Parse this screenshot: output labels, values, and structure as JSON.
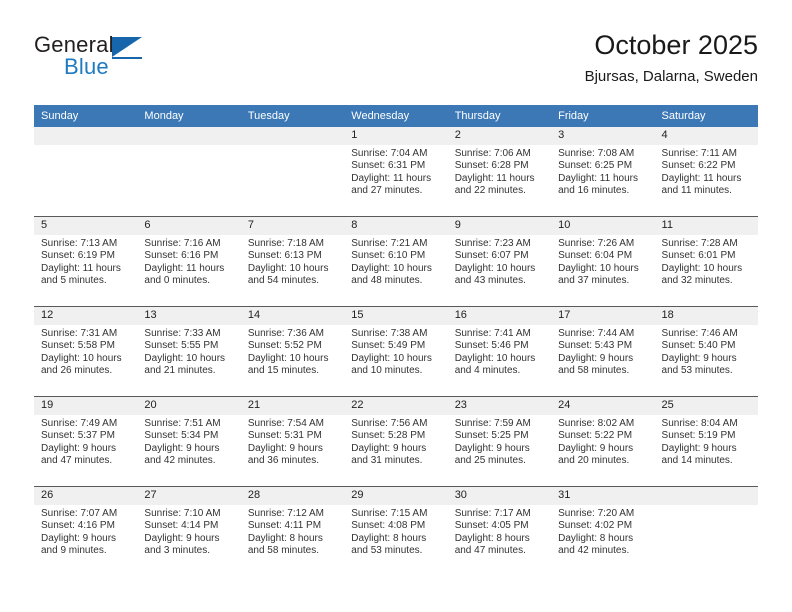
{
  "brand": {
    "name_top": "General",
    "name_bottom": "Blue",
    "flag_icon": "blue-triangle-flag-icon",
    "accent_color": "#1766ab"
  },
  "header": {
    "title": "October 2025",
    "subtitle": "Bjursas, Dalarna, Sweden"
  },
  "theme": {
    "header_bar": "#3b78b5",
    "daynum_band": "#f0f0f0",
    "row_divider": "#5a5a5a",
    "text": "#333333"
  },
  "weekday_headers": [
    "Sunday",
    "Monday",
    "Tuesday",
    "Wednesday",
    "Thursday",
    "Friday",
    "Saturday"
  ],
  "labels": {
    "sunrise": "Sunrise:",
    "sunset": "Sunset:",
    "daylight": "Daylight:"
  },
  "weeks": [
    [
      {
        "day": "",
        "sunrise": "",
        "sunset": "",
        "daylight": "",
        "blank": true
      },
      {
        "day": "",
        "sunrise": "",
        "sunset": "",
        "daylight": "",
        "blank": true
      },
      {
        "day": "",
        "sunrise": "",
        "sunset": "",
        "daylight": "",
        "blank": true
      },
      {
        "day": "1",
        "sunrise": "Sunrise: 7:04 AM",
        "sunset": "Sunset: 6:31 PM",
        "daylight": "Daylight: 11 hours and 27 minutes."
      },
      {
        "day": "2",
        "sunrise": "Sunrise: 7:06 AM",
        "sunset": "Sunset: 6:28 PM",
        "daylight": "Daylight: 11 hours and 22 minutes."
      },
      {
        "day": "3",
        "sunrise": "Sunrise: 7:08 AM",
        "sunset": "Sunset: 6:25 PM",
        "daylight": "Daylight: 11 hours and 16 minutes."
      },
      {
        "day": "4",
        "sunrise": "Sunrise: 7:11 AM",
        "sunset": "Sunset: 6:22 PM",
        "daylight": "Daylight: 11 hours and 11 minutes."
      }
    ],
    [
      {
        "day": "5",
        "sunrise": "Sunrise: 7:13 AM",
        "sunset": "Sunset: 6:19 PM",
        "daylight": "Daylight: 11 hours and 5 minutes."
      },
      {
        "day": "6",
        "sunrise": "Sunrise: 7:16 AM",
        "sunset": "Sunset: 6:16 PM",
        "daylight": "Daylight: 11 hours and 0 minutes."
      },
      {
        "day": "7",
        "sunrise": "Sunrise: 7:18 AM",
        "sunset": "Sunset: 6:13 PM",
        "daylight": "Daylight: 10 hours and 54 minutes."
      },
      {
        "day": "8",
        "sunrise": "Sunrise: 7:21 AM",
        "sunset": "Sunset: 6:10 PM",
        "daylight": "Daylight: 10 hours and 48 minutes."
      },
      {
        "day": "9",
        "sunrise": "Sunrise: 7:23 AM",
        "sunset": "Sunset: 6:07 PM",
        "daylight": "Daylight: 10 hours and 43 minutes."
      },
      {
        "day": "10",
        "sunrise": "Sunrise: 7:26 AM",
        "sunset": "Sunset: 6:04 PM",
        "daylight": "Daylight: 10 hours and 37 minutes."
      },
      {
        "day": "11",
        "sunrise": "Sunrise: 7:28 AM",
        "sunset": "Sunset: 6:01 PM",
        "daylight": "Daylight: 10 hours and 32 minutes."
      }
    ],
    [
      {
        "day": "12",
        "sunrise": "Sunrise: 7:31 AM",
        "sunset": "Sunset: 5:58 PM",
        "daylight": "Daylight: 10 hours and 26 minutes."
      },
      {
        "day": "13",
        "sunrise": "Sunrise: 7:33 AM",
        "sunset": "Sunset: 5:55 PM",
        "daylight": "Daylight: 10 hours and 21 minutes."
      },
      {
        "day": "14",
        "sunrise": "Sunrise: 7:36 AM",
        "sunset": "Sunset: 5:52 PM",
        "daylight": "Daylight: 10 hours and 15 minutes."
      },
      {
        "day": "15",
        "sunrise": "Sunrise: 7:38 AM",
        "sunset": "Sunset: 5:49 PM",
        "daylight": "Daylight: 10 hours and 10 minutes."
      },
      {
        "day": "16",
        "sunrise": "Sunrise: 7:41 AM",
        "sunset": "Sunset: 5:46 PM",
        "daylight": "Daylight: 10 hours and 4 minutes."
      },
      {
        "day": "17",
        "sunrise": "Sunrise: 7:44 AM",
        "sunset": "Sunset: 5:43 PM",
        "daylight": "Daylight: 9 hours and 58 minutes."
      },
      {
        "day": "18",
        "sunrise": "Sunrise: 7:46 AM",
        "sunset": "Sunset: 5:40 PM",
        "daylight": "Daylight: 9 hours and 53 minutes."
      }
    ],
    [
      {
        "day": "19",
        "sunrise": "Sunrise: 7:49 AM",
        "sunset": "Sunset: 5:37 PM",
        "daylight": "Daylight: 9 hours and 47 minutes."
      },
      {
        "day": "20",
        "sunrise": "Sunrise: 7:51 AM",
        "sunset": "Sunset: 5:34 PM",
        "daylight": "Daylight: 9 hours and 42 minutes."
      },
      {
        "day": "21",
        "sunrise": "Sunrise: 7:54 AM",
        "sunset": "Sunset: 5:31 PM",
        "daylight": "Daylight: 9 hours and 36 minutes."
      },
      {
        "day": "22",
        "sunrise": "Sunrise: 7:56 AM",
        "sunset": "Sunset: 5:28 PM",
        "daylight": "Daylight: 9 hours and 31 minutes."
      },
      {
        "day": "23",
        "sunrise": "Sunrise: 7:59 AM",
        "sunset": "Sunset: 5:25 PM",
        "daylight": "Daylight: 9 hours and 25 minutes."
      },
      {
        "day": "24",
        "sunrise": "Sunrise: 8:02 AM",
        "sunset": "Sunset: 5:22 PM",
        "daylight": "Daylight: 9 hours and 20 minutes."
      },
      {
        "day": "25",
        "sunrise": "Sunrise: 8:04 AM",
        "sunset": "Sunset: 5:19 PM",
        "daylight": "Daylight: 9 hours and 14 minutes."
      }
    ],
    [
      {
        "day": "26",
        "sunrise": "Sunrise: 7:07 AM",
        "sunset": "Sunset: 4:16 PM",
        "daylight": "Daylight: 9 hours and 9 minutes."
      },
      {
        "day": "27",
        "sunrise": "Sunrise: 7:10 AM",
        "sunset": "Sunset: 4:14 PM",
        "daylight": "Daylight: 9 hours and 3 minutes."
      },
      {
        "day": "28",
        "sunrise": "Sunrise: 7:12 AM",
        "sunset": "Sunset: 4:11 PM",
        "daylight": "Daylight: 8 hours and 58 minutes."
      },
      {
        "day": "29",
        "sunrise": "Sunrise: 7:15 AM",
        "sunset": "Sunset: 4:08 PM",
        "daylight": "Daylight: 8 hours and 53 minutes."
      },
      {
        "day": "30",
        "sunrise": "Sunrise: 7:17 AM",
        "sunset": "Sunset: 4:05 PM",
        "daylight": "Daylight: 8 hours and 47 minutes."
      },
      {
        "day": "31",
        "sunrise": "Sunrise: 7:20 AM",
        "sunset": "Sunset: 4:02 PM",
        "daylight": "Daylight: 8 hours and 42 minutes."
      },
      {
        "day": "",
        "sunrise": "",
        "sunset": "",
        "daylight": "",
        "blank": true
      }
    ]
  ]
}
